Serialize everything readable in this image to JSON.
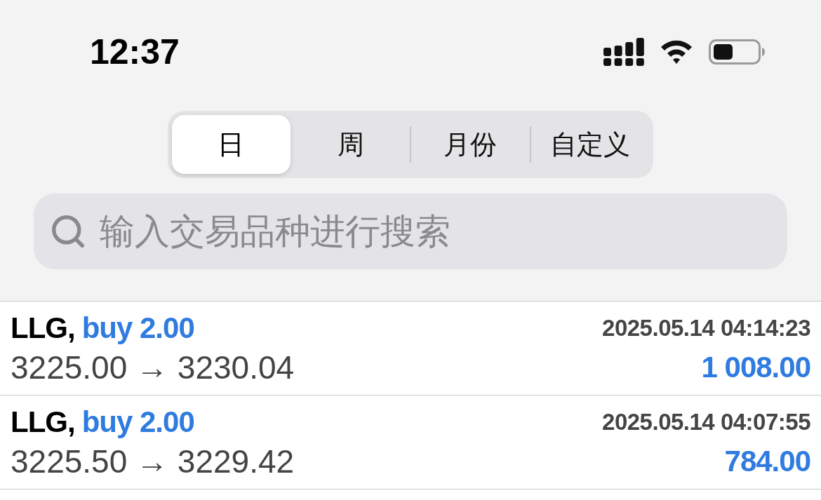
{
  "status_bar": {
    "time": "12:37"
  },
  "period_tabs": [
    {
      "label": "日",
      "selected": true
    },
    {
      "label": "周",
      "selected": false
    },
    {
      "label": "月份",
      "selected": false
    },
    {
      "label": "自定义",
      "selected": false
    }
  ],
  "search": {
    "placeholder": "输入交易品种进行搜索"
  },
  "trades": [
    {
      "symbol": "LLG,",
      "side": "buy 2.00",
      "time": "2025.05.14 04:14:23",
      "prices": "3225.00 → 3230.04",
      "profit": "1 008.00"
    },
    {
      "symbol": "LLG,",
      "side": "buy 2.00",
      "time": "2025.05.14 04:07:55",
      "prices": "3225.50 → 3229.42",
      "profit": "784.00"
    }
  ]
}
